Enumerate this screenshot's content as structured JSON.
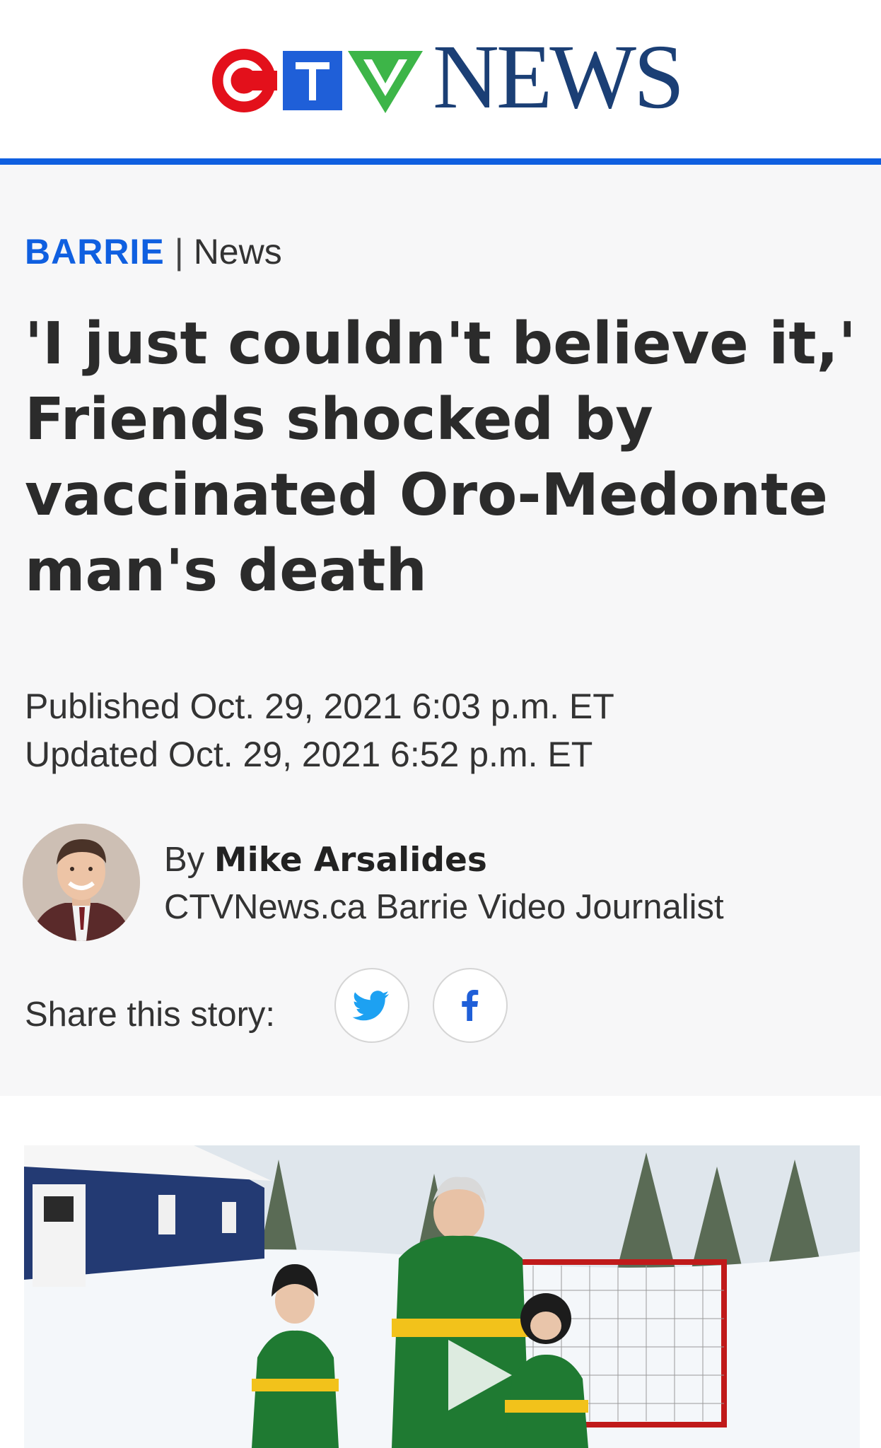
{
  "brand": {
    "logo_text": "CTV",
    "logo_word": "NEWS",
    "colors": {
      "red": "#e3101b",
      "blue": "#1f5fd8",
      "green": "#3db548",
      "navy": "#1b3f75",
      "accent": "#0f5fe0"
    }
  },
  "article": {
    "category": {
      "region": "BARRIE",
      "separator": "|",
      "section": "News"
    },
    "headline": "'I just couldn't believe it,' Friends shocked by vaccinated Oro-Medonte man's death",
    "published": "Published Oct. 29, 2021 6:03 p.m. ET",
    "updated": "Updated Oct. 29, 2021 6:52 p.m. ET",
    "author": {
      "prefix": "By",
      "name": "Mike Arsalides",
      "title": "CTVNews.ca Barrie Video Journalist"
    },
    "share": {
      "label": "Share this story:",
      "buttons": [
        {
          "name": "Twitter",
          "icon": "twitter-icon"
        },
        {
          "name": "Facebook",
          "icon": "facebook-icon"
        }
      ]
    },
    "media": {
      "type": "video",
      "icon": "play-icon"
    }
  }
}
